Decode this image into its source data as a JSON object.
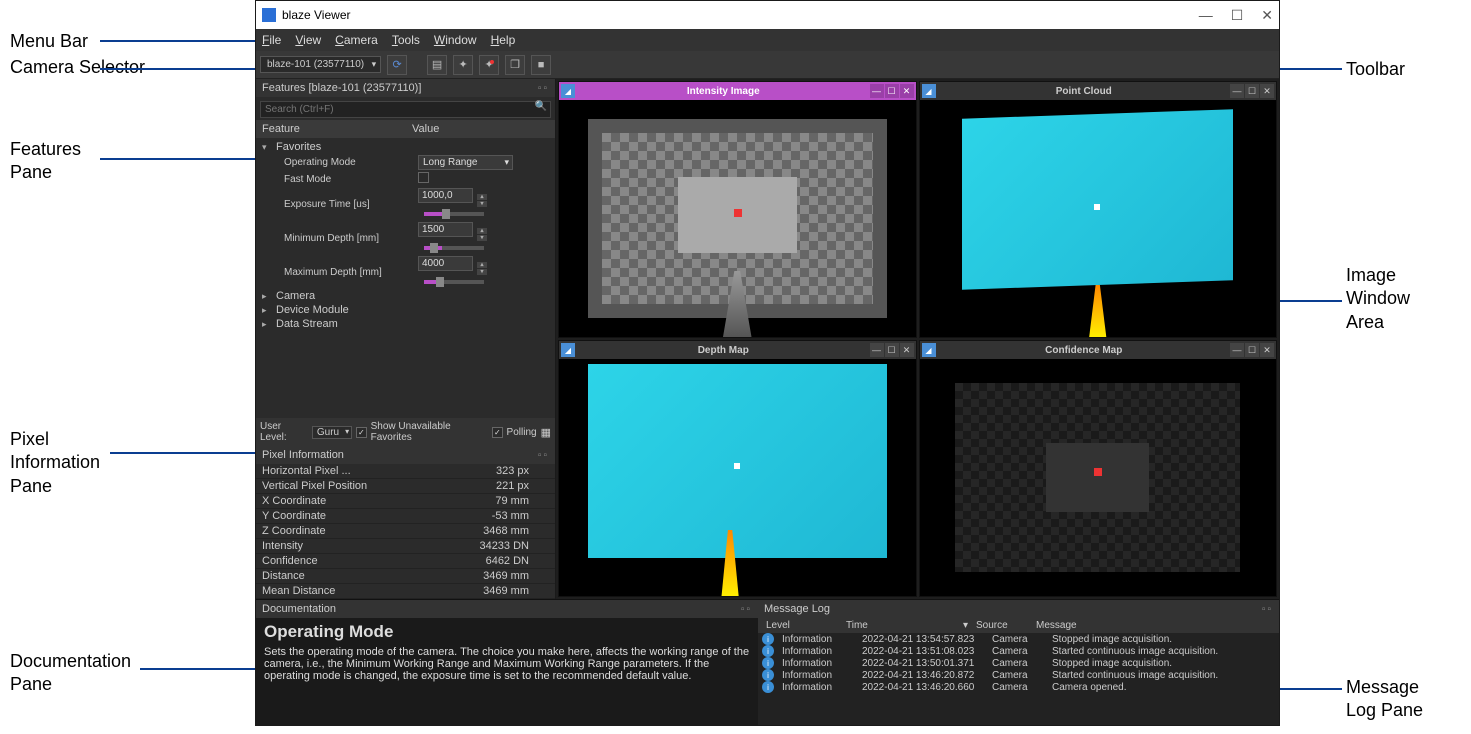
{
  "window": {
    "title": "blaze Viewer"
  },
  "menubar": [
    "File",
    "View",
    "Camera",
    "Tools",
    "Window",
    "Help"
  ],
  "toolbar": {
    "camera_selector": "blaze-101 (23577110)"
  },
  "features": {
    "title": "Features [blaze-101 (23577110)]",
    "search_placeholder": "Search (Ctrl+F)",
    "columns": [
      "Feature",
      "Value"
    ],
    "favorites_label": "Favorites",
    "rows": {
      "operating_mode": {
        "label": "Operating Mode",
        "value": "Long Range"
      },
      "fast_mode": {
        "label": "Fast Mode"
      },
      "exposure_time": {
        "label": "Exposure Time [us]",
        "value": "1000,0"
      },
      "min_depth": {
        "label": "Minimum Depth [mm]",
        "value": "1500"
      },
      "max_depth": {
        "label": "Maximum Depth [mm]",
        "value": "4000"
      }
    },
    "groups": [
      "Camera",
      "Device Module",
      "Data Stream"
    ],
    "footer": {
      "user_level_label": "User Level:",
      "user_level": "Guru",
      "show_unavailable": "Show Unavailable Favorites",
      "polling": "Polling"
    }
  },
  "pixel_info": {
    "title": "Pixel Information",
    "rows": [
      {
        "k": "Horizontal Pixel ...",
        "v": "323 px"
      },
      {
        "k": "Vertical Pixel Position",
        "v": "221 px"
      },
      {
        "k": "X Coordinate",
        "v": "79 mm"
      },
      {
        "k": "Y Coordinate",
        "v": "-53 mm"
      },
      {
        "k": "Z Coordinate",
        "v": "3468 mm"
      },
      {
        "k": "Intensity",
        "v": "34233 DN"
      },
      {
        "k": "Confidence",
        "v": "6462 DN"
      },
      {
        "k": "Distance",
        "v": "3469 mm"
      },
      {
        "k": "Mean Distance",
        "v": "3469 mm"
      }
    ]
  },
  "image_windows": {
    "intensity": "Intensity Image",
    "pointcloud": "Point Cloud",
    "depth": "Depth Map",
    "confidence": "Confidence Map"
  },
  "documentation": {
    "title": "Documentation",
    "heading": "Operating Mode",
    "body": "Sets the operating mode of the camera. The choice you make here, affects the working range of the camera, i.e., the Minimum Working Range and Maximum Working Range parameters. If the operating mode is changed, the exposure time is set to the recommended default value."
  },
  "message_log": {
    "title": "Message Log",
    "columns": [
      "Level",
      "Time",
      "Source",
      "Message"
    ],
    "rows": [
      {
        "level": "Information",
        "time": "2022-04-21 13:54:57.823",
        "source": "Camera",
        "message": "Stopped image acquisition."
      },
      {
        "level": "Information",
        "time": "2022-04-21 13:51:08.023",
        "source": "Camera",
        "message": "Started continuous image acquisition."
      },
      {
        "level": "Information",
        "time": "2022-04-21 13:50:01.371",
        "source": "Camera",
        "message": "Stopped image acquisition."
      },
      {
        "level": "Information",
        "time": "2022-04-21 13:46:20.872",
        "source": "Camera",
        "message": "Started continuous image acquisition."
      },
      {
        "level": "Information",
        "time": "2022-04-21 13:46:20.660",
        "source": "Camera",
        "message": "Camera opened."
      }
    ]
  },
  "annotations": {
    "menu_bar": "Menu Bar",
    "camera_selector": "Camera Selector",
    "features_pane": "Features Pane",
    "pixel_info_pane": "Pixel Information Pane",
    "documentation_pane": "Documentation Pane",
    "toolbar": "Toolbar",
    "image_window_area": "Image Window Area",
    "message_log_pane": "Message Log Pane"
  }
}
